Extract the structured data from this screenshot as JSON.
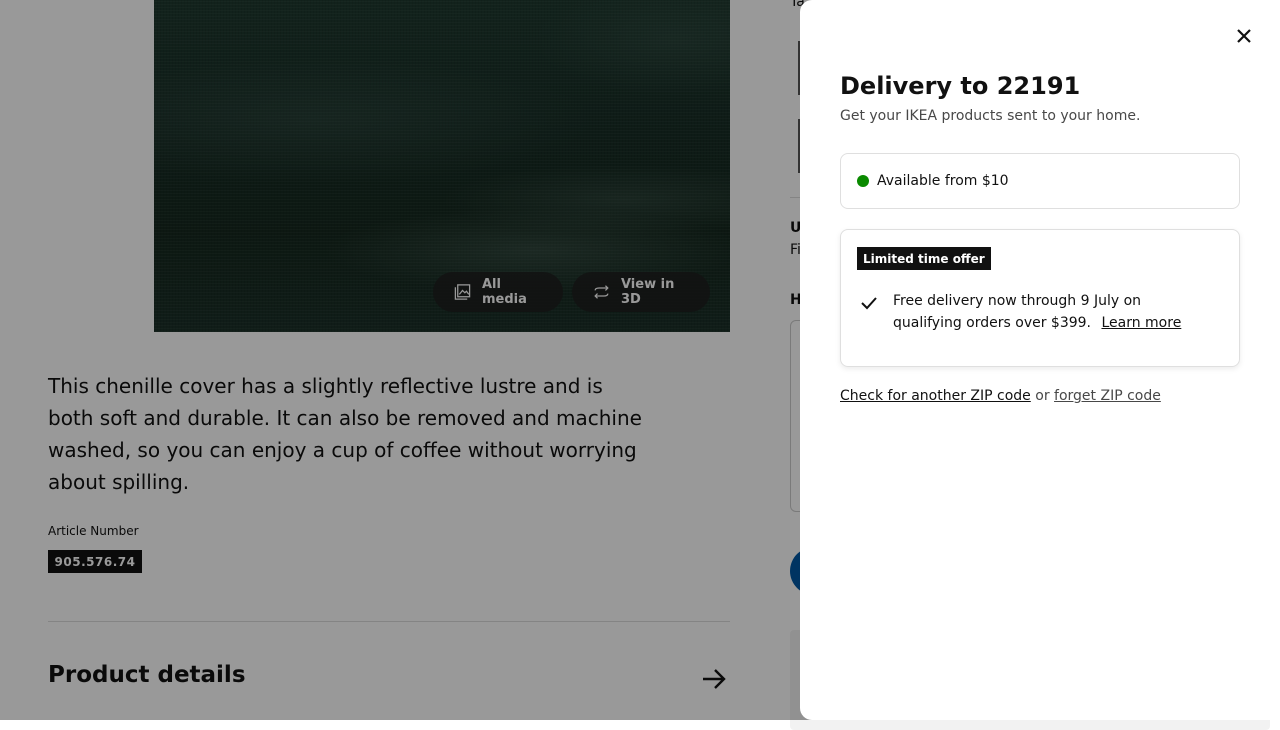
{
  "product": {
    "media_buttons": {
      "all_media": "All media",
      "view_3d": "View in 3D"
    },
    "description": "This chenille cover has a slightly reflective lustre and is both soft and durable. It can also be removed and machine washed, so you can enjoy a cup of coffee without worrying about spilling.",
    "article_label": "Article Number",
    "article_number": "905.576.74",
    "details_heading": "Product details"
  },
  "right_column": {
    "top_text": "Ta",
    "u_text": "U",
    "f_text": "Fi",
    "h_text": "H"
  },
  "modal": {
    "title": "Delivery to 22191",
    "subtitle": "Get your IKEA products sent to your home.",
    "availability": "Available from $10",
    "availability_color": "#0a8a00",
    "offer": {
      "badge": "Limited time offer",
      "text": "Free delivery now through 9 July on qualifying orders over $399.",
      "learn_more": "Learn more"
    },
    "zip": {
      "check_another": "Check for another ZIP code",
      "or": "or",
      "forget": "forget ZIP code"
    }
  },
  "icons": [
    "image-gallery-icon",
    "rotate-3d-icon",
    "arrow-right-icon",
    "close-icon",
    "check-icon"
  ]
}
